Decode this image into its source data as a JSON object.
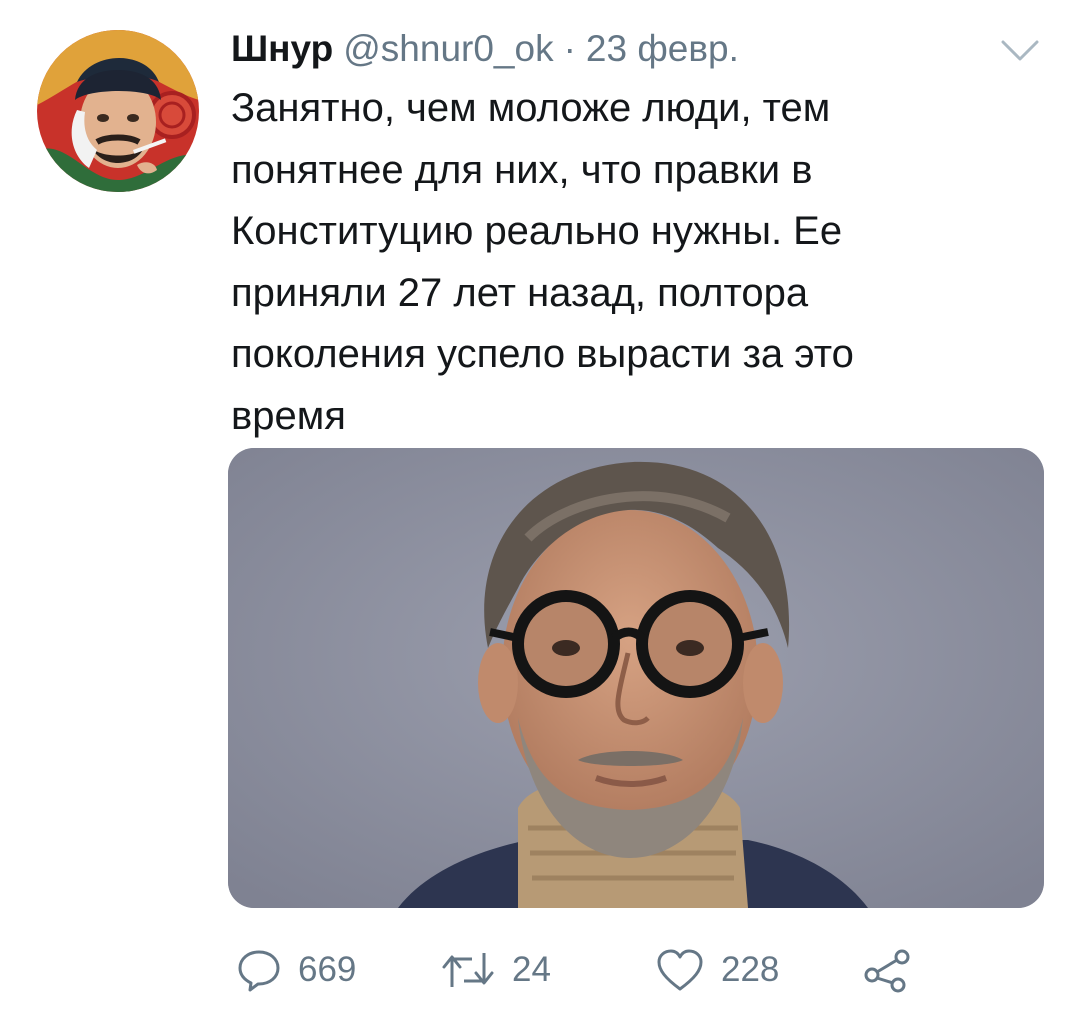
{
  "tweet": {
    "author": {
      "name": "Шнур",
      "handle": "@shnur0_ok",
      "avatar_icon": "avatar-portrait-painting"
    },
    "separator": "·",
    "date": "23 февр.",
    "menu_icon": "chevron-down-icon",
    "text_lines": [
      "Занятно, чем моложе люди, тем",
      "понятнее для них, что правки в",
      "Конституцию реально нужны. Ее",
      "приняли 27 лет назад, полтора",
      "поколения успело вырасти за это",
      "время"
    ],
    "media": {
      "kind": "photo-portrait-man-glasses"
    },
    "actions": {
      "reply": {
        "icon": "reply-icon",
        "count": "669"
      },
      "retweet": {
        "icon": "retweet-icon",
        "count": "24"
      },
      "like": {
        "icon": "heart-icon",
        "count": "228"
      },
      "share": {
        "icon": "share-icon"
      }
    }
  },
  "colors": {
    "text_primary": "#14171a",
    "text_secondary": "#657786",
    "background": "#ffffff"
  }
}
